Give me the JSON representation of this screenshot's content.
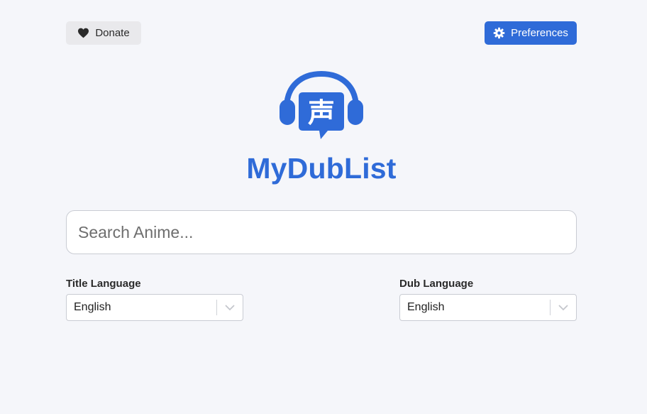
{
  "header": {
    "donate_label": "Donate",
    "donate_icon": "heart-icon",
    "preferences_label": "Preferences",
    "preferences_icon": "gear-icon"
  },
  "logo": {
    "icon": "headphones-speech-bubble-icon",
    "glyph": "声"
  },
  "app_title": "MyDubList",
  "search": {
    "value": "",
    "placeholder": "Search Anime..."
  },
  "title_language": {
    "label": "Title Language",
    "selected": "English"
  },
  "dub_language": {
    "label": "Dub Language",
    "selected": "English"
  },
  "colors": {
    "accent": "#2f6bd8",
    "background": "#f5f6fa",
    "donate_bg": "#e9e9ec"
  }
}
